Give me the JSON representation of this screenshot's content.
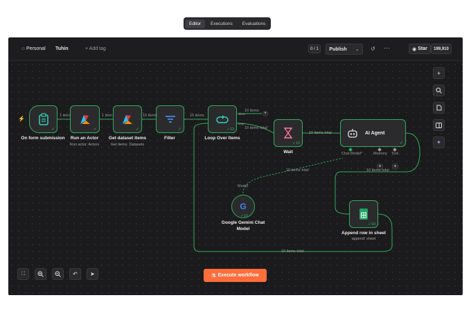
{
  "header": {
    "breadcrumb_parent": "Personal",
    "workflow_name": "Tuhin",
    "add_tag": "+ Add tag",
    "version_counter": "0 / 1",
    "publish_label": "Publish",
    "github_star": "Star",
    "star_count": "199,910"
  },
  "tabs": [
    {
      "label": "Editor",
      "active": true
    },
    {
      "label": "Executions",
      "active": false
    },
    {
      "label": "Evaluations",
      "active": false
    }
  ],
  "nodes": {
    "form": {
      "label": "On form submission",
      "icon": "clipboard-icon"
    },
    "actor": {
      "label": "Run an Actor",
      "sub": "Run actor: Actors",
      "icon": "apify-icon"
    },
    "dataset": {
      "label": "Get dataset items",
      "sub": "Get items: Datasets",
      "icon": "apify-icon"
    },
    "filter": {
      "label": "Filter",
      "icon": "filter-icon"
    },
    "loop": {
      "label": "Loop Over Items",
      "count": "13",
      "icon": "loop-icon"
    },
    "wait": {
      "label": "Wait",
      "count": "10",
      "icon": "hourglass-icon"
    },
    "agent": {
      "label": "AI Agent",
      "icon": "robot-icon"
    },
    "gemini": {
      "label_line1": "Google Gemini Chat",
      "label_line2": "Model",
      "count": "10",
      "icon": "google-icon"
    },
    "sheet": {
      "label": "Append row in sheet",
      "sub": "append: sheet",
      "count": "10",
      "icon": "sheets-icon"
    }
  },
  "edges": {
    "form_actor": "1 item",
    "actor_dataset": "1 item",
    "dataset_filter": "10 items",
    "filter_loop": "10 items",
    "loop_done_count": "10 items",
    "loop_done": "done",
    "loop_loop": "loop",
    "loop_total": "10 items total",
    "wait_agent": "10 items total",
    "gemini_agent": "10 items total",
    "agent_sheet": "10 items total",
    "sheet_loop": "10 items total",
    "gemini_port": "Model"
  },
  "agent_ports": {
    "chat_model": "Chat Model*",
    "memory": "Memory",
    "tool": "Tool"
  },
  "footer": {
    "execute_label": "Execute workflow"
  },
  "colors": {
    "success": "#2fae5b",
    "accent": "#ff6d3b",
    "background": "#1d1d1f"
  }
}
